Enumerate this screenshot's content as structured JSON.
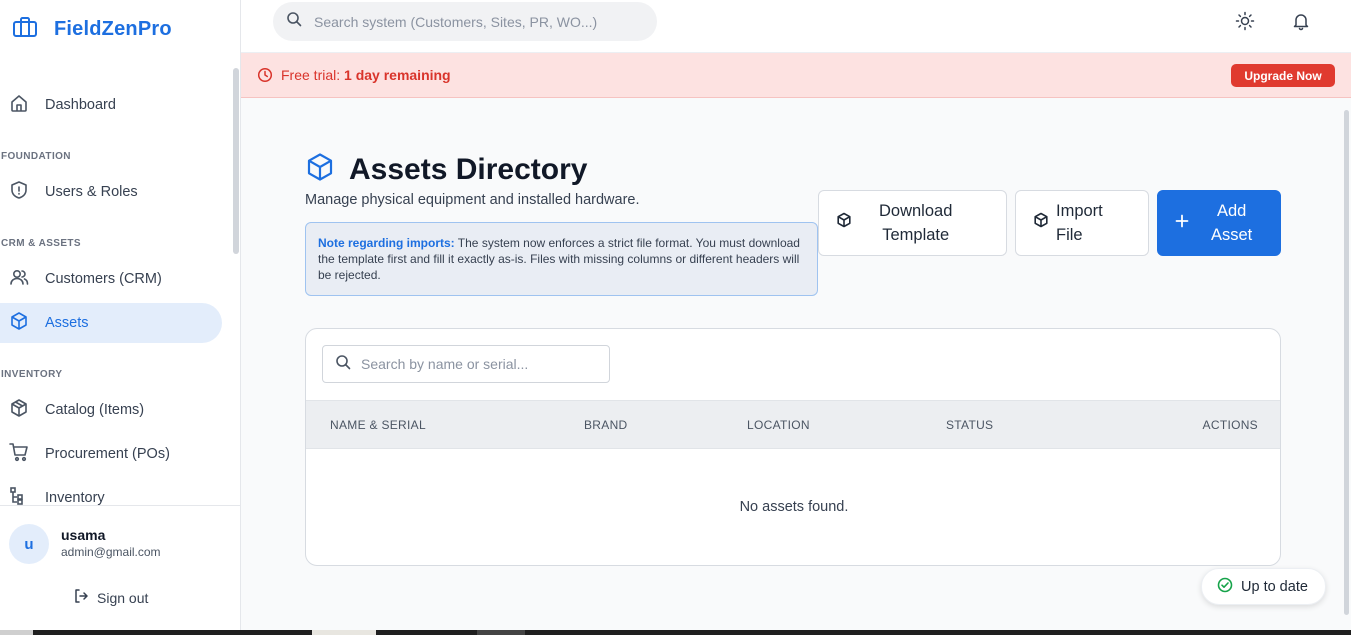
{
  "app": {
    "name": "FieldZenPro"
  },
  "sidebar": {
    "items": [
      {
        "label": "Dashboard",
        "icon": "home-icon"
      },
      {
        "label": "Users & Roles",
        "icon": "shield-icon"
      },
      {
        "label": "Customers (CRM)",
        "icon": "users-icon"
      },
      {
        "label": "Assets",
        "icon": "box-icon",
        "active": true
      },
      {
        "label": "Catalog (Items)",
        "icon": "box-icon"
      },
      {
        "label": "Procurement (POs)",
        "icon": "cart-icon"
      },
      {
        "label": "Inventory",
        "icon": "hierarchy-icon"
      }
    ],
    "sections": [
      "FOUNDATION",
      "CRM & ASSETS",
      "INVENTORY"
    ],
    "user": {
      "initial": "u",
      "name": "usama",
      "email": "admin@gmail.com"
    },
    "sign_out_label": "Sign out"
  },
  "topbar": {
    "search_placeholder": "Search system (Customers, Sites, PR, WO...)"
  },
  "trial_banner": {
    "prefix": "Free trial: ",
    "remaining": "1 day remaining",
    "upgrade_label": "Upgrade Now"
  },
  "page": {
    "title": "Assets Directory",
    "subtitle": "Manage physical equipment and installed hardware.",
    "note_label": "Note regarding imports:",
    "note_text": " The system now enforces a strict file format. You must download the template first and fill it exactly as-is. Files with missing columns or different headers will be rejected.",
    "buttons": {
      "download_template": "Download\nTemplate",
      "import_file": "Import\nFile",
      "add_asset": "Add\nAsset"
    }
  },
  "table": {
    "search_placeholder": "Search by name or serial...",
    "columns": [
      "NAME & SERIAL",
      "BRAND",
      "LOCATION",
      "STATUS",
      "ACTIONS"
    ],
    "empty_message": "No assets found."
  },
  "toast": {
    "label": "Up to date"
  },
  "colors": {
    "accent": "#1d6fe0",
    "danger": "#e03a2f",
    "banner_bg": "#fde2e1",
    "success": "#16a34a"
  }
}
